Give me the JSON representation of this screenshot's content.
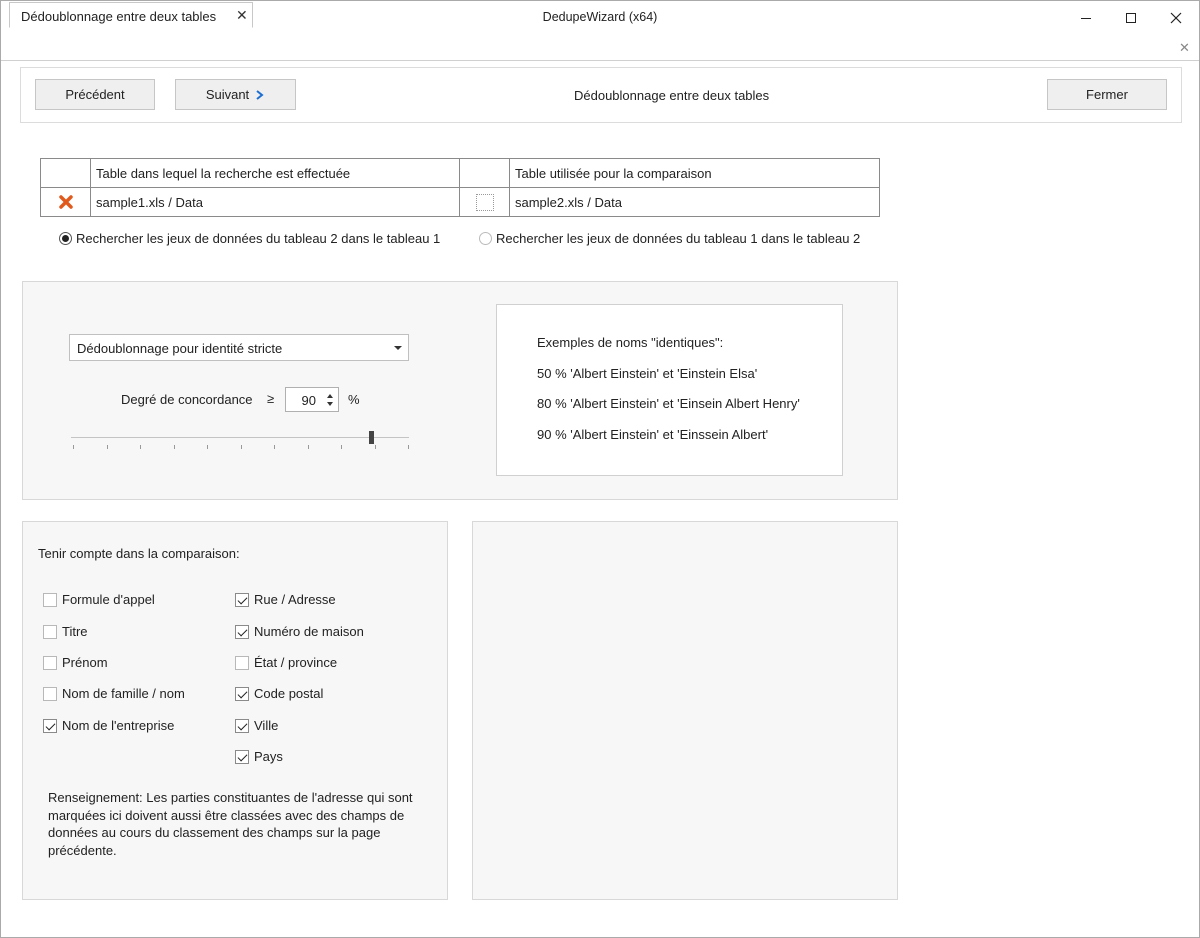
{
  "window": {
    "title": "DedupeWizard  (x64)"
  },
  "tab": {
    "label": "Dédoublonnage entre deux tables"
  },
  "toolbar": {
    "prev_label": "Précédent",
    "next_label": "Suivant",
    "title": "Dédoublonnage entre deux tables",
    "close_label": "Fermer"
  },
  "tables": {
    "header_left": "Table dans lequel la recherche est effectuée",
    "header_right": "Table utilisée pour la comparaison",
    "row_left": "sample1.xls / Data",
    "row_right": "sample2.xls / Data"
  },
  "search_mode": {
    "option1": "Rechercher les jeux de données du tableau 2 dans le tableau 1",
    "option2": "Rechercher les jeux de données du tableau 1 dans le tableau 2",
    "selected": 1
  },
  "matching": {
    "mode": "Dédoublonnage pour identité stricte",
    "degree_label": "Degré de concordance",
    "operator": "≥",
    "value": "90",
    "unit": "%",
    "slider_fraction": 0.9
  },
  "examples": {
    "title": "Exemples de noms \"identiques\":",
    "lines": [
      "50 %  'Albert Einstein' et 'Einstein Elsa'",
      "80 %  'Albert Einstein' et 'Einsein Albert Henry'",
      "90 %  'Albert Einstein' et 'Einssein Albert'"
    ]
  },
  "fields": {
    "title": "Tenir compte dans la comparaison:",
    "left": [
      {
        "label": "Formule d'appel",
        "checked": false
      },
      {
        "label": "Titre",
        "checked": false
      },
      {
        "label": "Prénom",
        "checked": false
      },
      {
        "label": "Nom de famille / nom",
        "checked": false
      },
      {
        "label": "Nom de l'entreprise",
        "checked": true
      }
    ],
    "right": [
      {
        "label": "Rue / Adresse",
        "checked": true
      },
      {
        "label": "Numéro de maison",
        "checked": true
      },
      {
        "label": "État / province",
        "checked": false
      },
      {
        "label": "Code postal",
        "checked": true
      },
      {
        "label": "Ville",
        "checked": true
      },
      {
        "label": "Pays",
        "checked": true
      }
    ],
    "hint": "Renseignement: Les parties constituantes de l'adresse qui sont marquées ici doivent aussi être classées avec des champs de données au cours du classement des champs sur la page précédente."
  }
}
